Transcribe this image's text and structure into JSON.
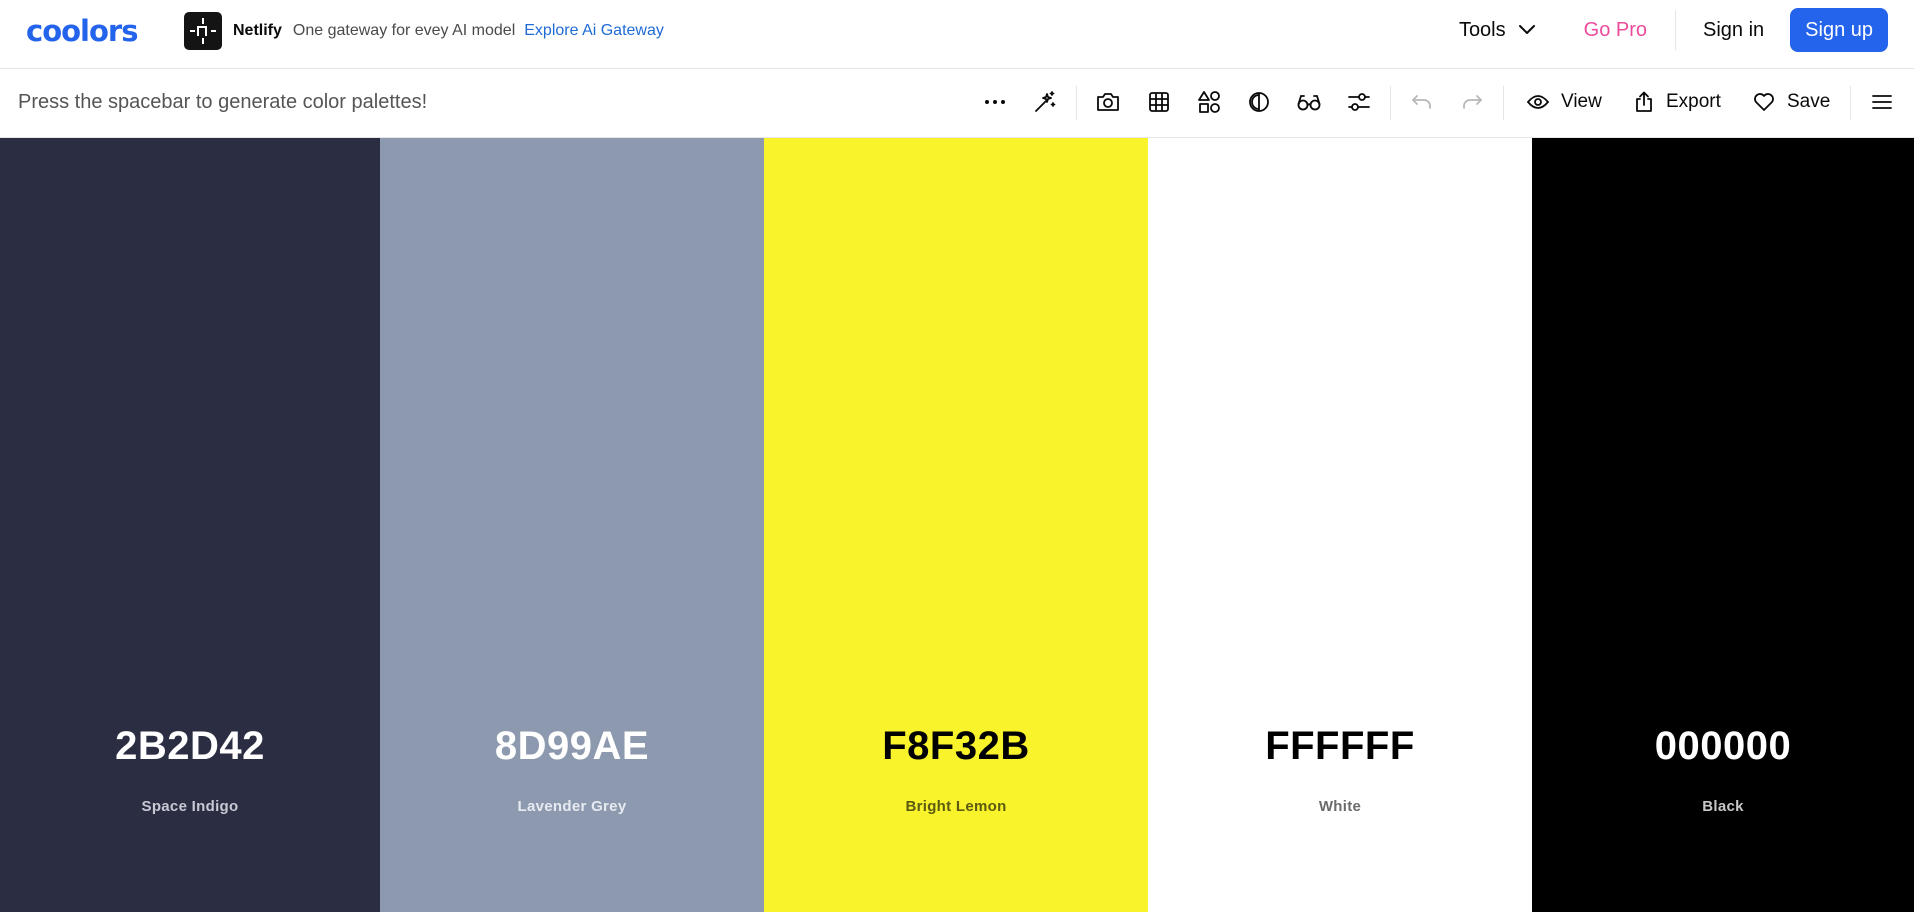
{
  "nav": {
    "logo_text": "coolors",
    "ad": {
      "brand": "Netlify",
      "text": "One gateway for evey AI model",
      "link": "Explore Ai Gateway"
    },
    "tools_label": "Tools",
    "gopro_label": "Go Pro",
    "signin_label": "Sign in",
    "signup_label": "Sign up"
  },
  "toolbar": {
    "hint": "Press the spacebar to generate color palettes!",
    "icons": [
      "more-icon",
      "magic-wand-icon",
      "camera-icon",
      "grid-icon",
      "shapes-icon",
      "contrast-icon",
      "glasses-icon",
      "sliders-icon",
      "undo-icon",
      "redo-icon"
    ],
    "view_label": "View",
    "export_label": "Export",
    "save_label": "Save",
    "menu_icon": "hamburger-icon"
  },
  "colors": {
    "brand_blue": "#2463eb",
    "gopro_pink": "#ec4c9b"
  },
  "palette": [
    {
      "hex": "2B2D42",
      "name": "Space Indigo",
      "bg": "#2b2d42",
      "hex_color": "#ffffff",
      "name_color": "#c7c9d3"
    },
    {
      "hex": "8D99AE",
      "name": "Lavender Grey",
      "bg": "#8d99ae",
      "hex_color": "#ffffff",
      "name_color": "#e7ebf1"
    },
    {
      "hex": "F8F32B",
      "name": "Bright Lemon",
      "bg": "#f8f32b",
      "hex_color": "#000000",
      "name_color": "#5c5a10"
    },
    {
      "hex": "FFFFFF",
      "name": "White",
      "bg": "#ffffff",
      "hex_color": "#000000",
      "name_color": "#6b6b6b"
    },
    {
      "hex": "000000",
      "name": "Black",
      "bg": "#000000",
      "hex_color": "#ffffff",
      "name_color": "#c8c8c8"
    }
  ]
}
